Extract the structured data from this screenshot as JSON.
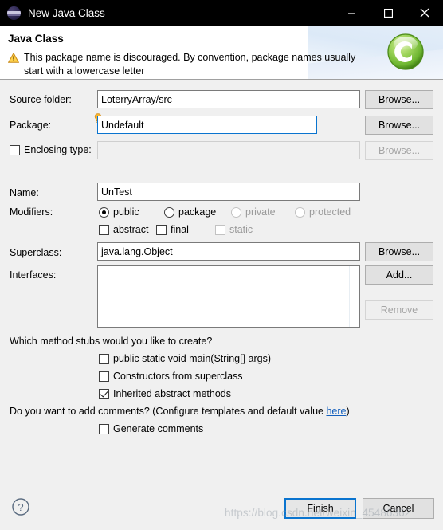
{
  "window": {
    "title": "New Java Class",
    "icon": "eclipse-icon",
    "controls": {
      "minimize": "minimize-icon",
      "maximize": "maximize-icon",
      "close": "close-icon"
    }
  },
  "banner": {
    "heading": "Java Class",
    "warning_icon": "warning-triangle-icon",
    "warning_message": "This package name is discouraged. By convention, package names usually start with a lowercase letter",
    "badge_icon": "java-class-green-c-icon"
  },
  "fields": {
    "source_folder": {
      "label": "Source folder:",
      "value": "LoterryArray/src",
      "browse_label": "Browse...",
      "browse_enabled": true
    },
    "package": {
      "label": "Package:",
      "value": "Undefault",
      "browse_label": "Browse...",
      "browse_enabled": true,
      "focused": true,
      "marker_icon": "lightbulb-hint-icon"
    },
    "enclosing_type": {
      "label": "Enclosing type:",
      "checked": false,
      "value": "",
      "browse_label": "Browse...",
      "browse_enabled": false
    },
    "name": {
      "label": "Name:",
      "value": "UnTest"
    },
    "superclass": {
      "label": "Superclass:",
      "value": "java.lang.Object",
      "browse_label": "Browse...",
      "browse_enabled": true
    },
    "interfaces": {
      "label": "Interfaces:",
      "items": [],
      "add_label": "Add...",
      "remove_label": "Remove",
      "remove_enabled": false
    }
  },
  "modifiers": {
    "label": "Modifiers:",
    "access": [
      {
        "label": "public",
        "selected": true,
        "enabled": true
      },
      {
        "label": "package",
        "selected": false,
        "enabled": true
      },
      {
        "label": "private",
        "selected": false,
        "enabled": false
      },
      {
        "label": "protected",
        "selected": false,
        "enabled": false
      }
    ],
    "flags": [
      {
        "label": "abstract",
        "checked": false,
        "enabled": true
      },
      {
        "label": "final",
        "checked": false,
        "enabled": true
      },
      {
        "label": "static",
        "checked": false,
        "enabled": false
      }
    ]
  },
  "stubs": {
    "question": "Which method stubs would you like to create?",
    "options": [
      {
        "label": "public static void main(String[] args)",
        "checked": false
      },
      {
        "label": "Constructors from superclass",
        "checked": false
      },
      {
        "label": "Inherited abstract methods",
        "checked": true
      }
    ]
  },
  "comments": {
    "question_prefix": "Do you want to add comments? (Configure templates and default value ",
    "link_label": "here",
    "question_suffix": ")",
    "option": {
      "label": "Generate comments",
      "checked": false
    }
  },
  "footer": {
    "help_icon": "help-question-icon",
    "finish_label": "Finish",
    "cancel_label": "Cancel",
    "watermark": "https://blog.csdn.net/weixin_45486362"
  },
  "colors": {
    "titlebar_bg": "#000000",
    "dialog_bg": "#f0f0f0",
    "banner_bg": "#ffffff",
    "focus_blue": "#0a74cf",
    "link_blue": "#1560bd",
    "warning_amber": "#f0b429",
    "badge_green": "#72bf44"
  }
}
